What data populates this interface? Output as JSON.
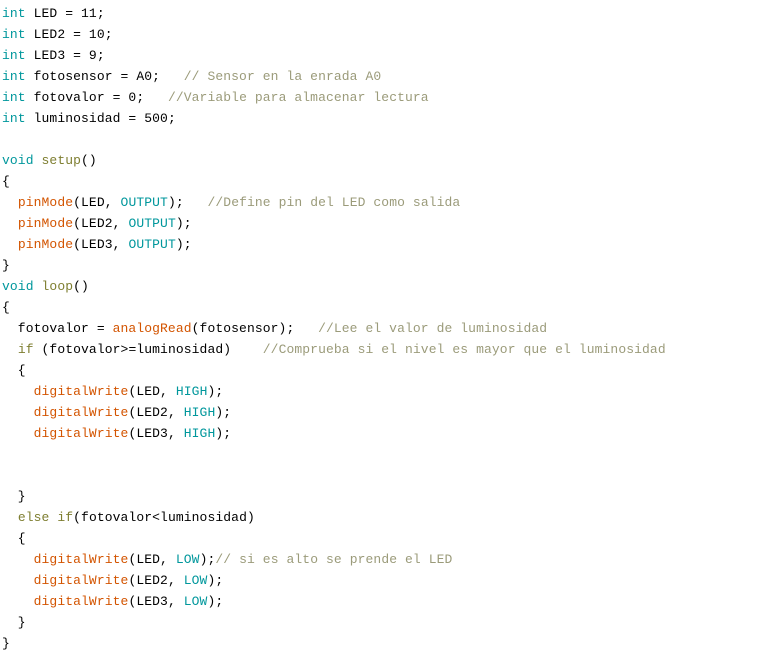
{
  "document": {
    "kind": "source-code-listing",
    "language": "Arduino C++",
    "background_color": "#ffffff"
  },
  "theme": {
    "plain": "#000000",
    "keyword": "#00979c",
    "keyword2": "#7e7e30",
    "function": "#d35400",
    "comment": "#9b9b7a"
  },
  "code": {
    "lines": [
      {
        "indent": 0,
        "tokens": [
          {
            "t": "int",
            "c": "keyword"
          },
          {
            "t": " LED = 11;",
            "c": "plain"
          }
        ]
      },
      {
        "indent": 0,
        "tokens": [
          {
            "t": "int",
            "c": "keyword"
          },
          {
            "t": " LED2 = 10;",
            "c": "plain"
          }
        ]
      },
      {
        "indent": 0,
        "tokens": [
          {
            "t": "int",
            "c": "keyword"
          },
          {
            "t": " LED3 = 9;",
            "c": "plain"
          }
        ]
      },
      {
        "indent": 0,
        "tokens": [
          {
            "t": "int",
            "c": "keyword"
          },
          {
            "t": " fotosensor = A0;   ",
            "c": "plain"
          },
          {
            "t": "// Sensor en la enrada A0",
            "c": "comment"
          }
        ]
      },
      {
        "indent": 0,
        "tokens": [
          {
            "t": "int",
            "c": "keyword"
          },
          {
            "t": " fotovalor = 0;   ",
            "c": "plain"
          },
          {
            "t": "//Variable para almacenar lectura",
            "c": "comment"
          }
        ]
      },
      {
        "indent": 0,
        "tokens": [
          {
            "t": "int",
            "c": "keyword"
          },
          {
            "t": " luminosidad = 500;",
            "c": "plain"
          }
        ]
      },
      {
        "indent": 0,
        "tokens": []
      },
      {
        "indent": 0,
        "tokens": [
          {
            "t": "void",
            "c": "keyword"
          },
          {
            "t": " ",
            "c": "plain"
          },
          {
            "t": "setup",
            "c": "keyword2"
          },
          {
            "t": "()",
            "c": "plain"
          }
        ]
      },
      {
        "indent": 0,
        "tokens": [
          {
            "t": "{",
            "c": "brace"
          }
        ]
      },
      {
        "indent": 0,
        "tokens": [
          {
            "t": "  ",
            "c": "plain"
          },
          {
            "t": "pinMode",
            "c": "function"
          },
          {
            "t": "(LED, ",
            "c": "plain"
          },
          {
            "t": "OUTPUT",
            "c": "keyword"
          },
          {
            "t": ");   ",
            "c": "plain"
          },
          {
            "t": "//Define pin del LED como salida",
            "c": "comment"
          }
        ]
      },
      {
        "indent": 0,
        "tokens": [
          {
            "t": "  ",
            "c": "plain"
          },
          {
            "t": "pinMode",
            "c": "function"
          },
          {
            "t": "(LED2, ",
            "c": "plain"
          },
          {
            "t": "OUTPUT",
            "c": "keyword"
          },
          {
            "t": ");",
            "c": "plain"
          }
        ]
      },
      {
        "indent": 0,
        "tokens": [
          {
            "t": "  ",
            "c": "plain"
          },
          {
            "t": "pinMode",
            "c": "function"
          },
          {
            "t": "(LED3, ",
            "c": "plain"
          },
          {
            "t": "OUTPUT",
            "c": "keyword"
          },
          {
            "t": ");",
            "c": "plain"
          }
        ]
      },
      {
        "indent": 0,
        "tokens": [
          {
            "t": "}",
            "c": "brace"
          }
        ]
      },
      {
        "indent": 0,
        "tokens": [
          {
            "t": "void",
            "c": "keyword"
          },
          {
            "t": " ",
            "c": "plain"
          },
          {
            "t": "loop",
            "c": "keyword2"
          },
          {
            "t": "()",
            "c": "plain"
          }
        ]
      },
      {
        "indent": 0,
        "tokens": [
          {
            "t": "{",
            "c": "brace"
          }
        ]
      },
      {
        "indent": 0,
        "tokens": [
          {
            "t": "  fotovalor = ",
            "c": "plain"
          },
          {
            "t": "analogRead",
            "c": "function"
          },
          {
            "t": "(fotosensor);   ",
            "c": "plain"
          },
          {
            "t": "//Lee el valor de luminosidad",
            "c": "comment"
          }
        ]
      },
      {
        "indent": 0,
        "tokens": [
          {
            "t": "  ",
            "c": "plain"
          },
          {
            "t": "if",
            "c": "keyword2"
          },
          {
            "t": " (fotovalor>=luminosidad)    ",
            "c": "plain"
          },
          {
            "t": "//Comprueba si el nivel es mayor que el luminosidad",
            "c": "comment"
          }
        ]
      },
      {
        "indent": 0,
        "tokens": [
          {
            "t": "  {",
            "c": "brace"
          }
        ]
      },
      {
        "indent": 0,
        "tokens": [
          {
            "t": "    ",
            "c": "plain"
          },
          {
            "t": "digitalWrite",
            "c": "function"
          },
          {
            "t": "(LED, ",
            "c": "plain"
          },
          {
            "t": "HIGH",
            "c": "keyword"
          },
          {
            "t": ");",
            "c": "plain"
          }
        ]
      },
      {
        "indent": 0,
        "tokens": [
          {
            "t": "    ",
            "c": "plain"
          },
          {
            "t": "digitalWrite",
            "c": "function"
          },
          {
            "t": "(LED2, ",
            "c": "plain"
          },
          {
            "t": "HIGH",
            "c": "keyword"
          },
          {
            "t": ");",
            "c": "plain"
          }
        ]
      },
      {
        "indent": 0,
        "tokens": [
          {
            "t": "    ",
            "c": "plain"
          },
          {
            "t": "digitalWrite",
            "c": "function"
          },
          {
            "t": "(LED3, ",
            "c": "plain"
          },
          {
            "t": "HIGH",
            "c": "keyword"
          },
          {
            "t": ");",
            "c": "plain"
          }
        ]
      },
      {
        "indent": 0,
        "tokens": []
      },
      {
        "indent": 0,
        "tokens": []
      },
      {
        "indent": 0,
        "tokens": [
          {
            "t": "  }",
            "c": "brace"
          }
        ]
      },
      {
        "indent": 0,
        "tokens": [
          {
            "t": "  ",
            "c": "plain"
          },
          {
            "t": "else",
            "c": "keyword2"
          },
          {
            "t": " ",
            "c": "plain"
          },
          {
            "t": "if",
            "c": "keyword2"
          },
          {
            "t": "(fotovalor<luminosidad)",
            "c": "plain"
          }
        ]
      },
      {
        "indent": 0,
        "tokens": [
          {
            "t": "  {",
            "c": "brace"
          }
        ]
      },
      {
        "indent": 0,
        "tokens": [
          {
            "t": "    ",
            "c": "plain"
          },
          {
            "t": "digitalWrite",
            "c": "function"
          },
          {
            "t": "(LED, ",
            "c": "plain"
          },
          {
            "t": "LOW",
            "c": "keyword"
          },
          {
            "t": ");",
            "c": "plain"
          },
          {
            "t": "// si es alto se prende el LED",
            "c": "comment"
          }
        ]
      },
      {
        "indent": 0,
        "tokens": [
          {
            "t": "    ",
            "c": "plain"
          },
          {
            "t": "digitalWrite",
            "c": "function"
          },
          {
            "t": "(LED2, ",
            "c": "plain"
          },
          {
            "t": "LOW",
            "c": "keyword"
          },
          {
            "t": ");",
            "c": "plain"
          }
        ]
      },
      {
        "indent": 0,
        "tokens": [
          {
            "t": "    ",
            "c": "plain"
          },
          {
            "t": "digitalWrite",
            "c": "function"
          },
          {
            "t": "(LED3, ",
            "c": "plain"
          },
          {
            "t": "LOW",
            "c": "keyword"
          },
          {
            "t": ");",
            "c": "plain"
          }
        ]
      },
      {
        "indent": 0,
        "tokens": [
          {
            "t": "  }",
            "c": "brace"
          }
        ]
      },
      {
        "indent": 0,
        "tokens": [
          {
            "t": "}",
            "c": "brace"
          }
        ]
      }
    ]
  }
}
